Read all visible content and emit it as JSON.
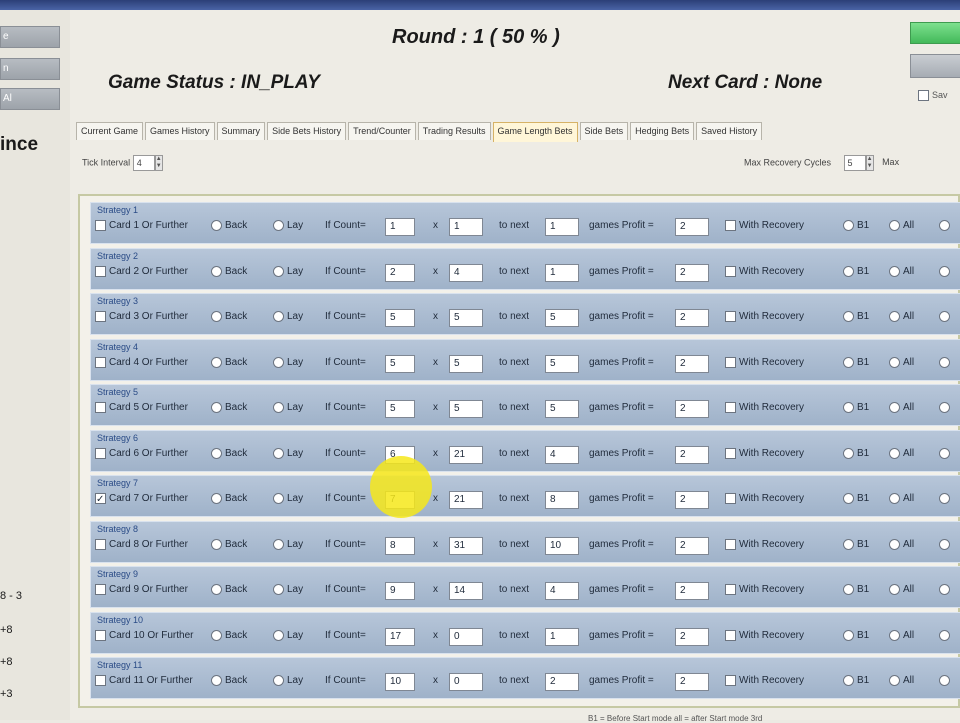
{
  "header": {
    "round_text": "Round : 1    ( 50 % )",
    "game_status": "Game Status : IN_PLAY",
    "next_card": "Next Card : None"
  },
  "left_panel": {
    "buttons": [
      "e",
      "n",
      "Al"
    ],
    "since": "ince",
    "scores": [
      "8 - 3",
      "+8",
      "+8",
      "+3"
    ]
  },
  "tabs": [
    {
      "label": "Current Game",
      "active": false
    },
    {
      "label": "Games History",
      "active": false
    },
    {
      "label": "Summary",
      "active": false
    },
    {
      "label": "Side Bets History",
      "active": false
    },
    {
      "label": "Trend/Counter",
      "active": false
    },
    {
      "label": "Trading Results",
      "active": false
    },
    {
      "label": "Game Length Bets",
      "active": true
    },
    {
      "label": "Side Bets",
      "active": false
    },
    {
      "label": "Hedging Bets",
      "active": false
    },
    {
      "label": "Saved History",
      "active": false
    }
  ],
  "controls": {
    "left_label": "Tick Interval",
    "left_value": "4",
    "right_label": "Max Recovery Cycles",
    "right_value": "5",
    "right_extra": "Max",
    "save_label": "Sav"
  },
  "row_labels": {
    "back": "Back",
    "lay": "Lay",
    "count": "If Count=",
    "x": "x",
    "to_next": "to next",
    "games_profit": "games Profit =",
    "with_recovery": "With Recovery",
    "b1": "B1",
    "all": "All"
  },
  "strategies": [
    {
      "title": "Strategy 1",
      "card": "Card 1 Or Further",
      "count": "1",
      "mult": "1",
      "next": "1",
      "profit": "2",
      "card_checked": false
    },
    {
      "title": "Strategy 2",
      "card": "Card 2 Or Further",
      "count": "2",
      "mult": "4",
      "next": "1",
      "profit": "2",
      "card_checked": false
    },
    {
      "title": "Strategy 3",
      "card": "Card 3 Or Further",
      "count": "5",
      "mult": "5",
      "next": "5",
      "profit": "2",
      "card_checked": false
    },
    {
      "title": "Strategy 4",
      "card": "Card 4 Or Further",
      "count": "5",
      "mult": "5",
      "next": "5",
      "profit": "2",
      "card_checked": false
    },
    {
      "title": "Strategy 5",
      "card": "Card 5 Or Further",
      "count": "5",
      "mult": "5",
      "next": "5",
      "profit": "2",
      "card_checked": false
    },
    {
      "title": "Strategy 6",
      "card": "Card 6 Or Further",
      "count": "6",
      "mult": "21",
      "next": "4",
      "profit": "2",
      "card_checked": false
    },
    {
      "title": "Strategy 7",
      "card": "Card 7 Or Further",
      "count": "7",
      "mult": "21",
      "next": "8",
      "profit": "2",
      "card_checked": true
    },
    {
      "title": "Strategy 8",
      "card": "Card 8 Or Further",
      "count": "8",
      "mult": "31",
      "next": "10",
      "profit": "2",
      "card_checked": false
    },
    {
      "title": "Strategy 9",
      "card": "Card 9 Or Further",
      "count": "9",
      "mult": "14",
      "next": "4",
      "profit": "2",
      "card_checked": false
    },
    {
      "title": "Strategy 10",
      "card": "Card 10 Or Further",
      "count": "17",
      "mult": "0",
      "next": "1",
      "profit": "2",
      "card_checked": false
    },
    {
      "title": "Strategy 11",
      "card": "Card 11 Or Further",
      "count": "10",
      "mult": "0",
      "next": "2",
      "profit": "2",
      "card_checked": false
    }
  ],
  "footnote": "B1 = Before Start mode    all = after Start mode   3rd"
}
